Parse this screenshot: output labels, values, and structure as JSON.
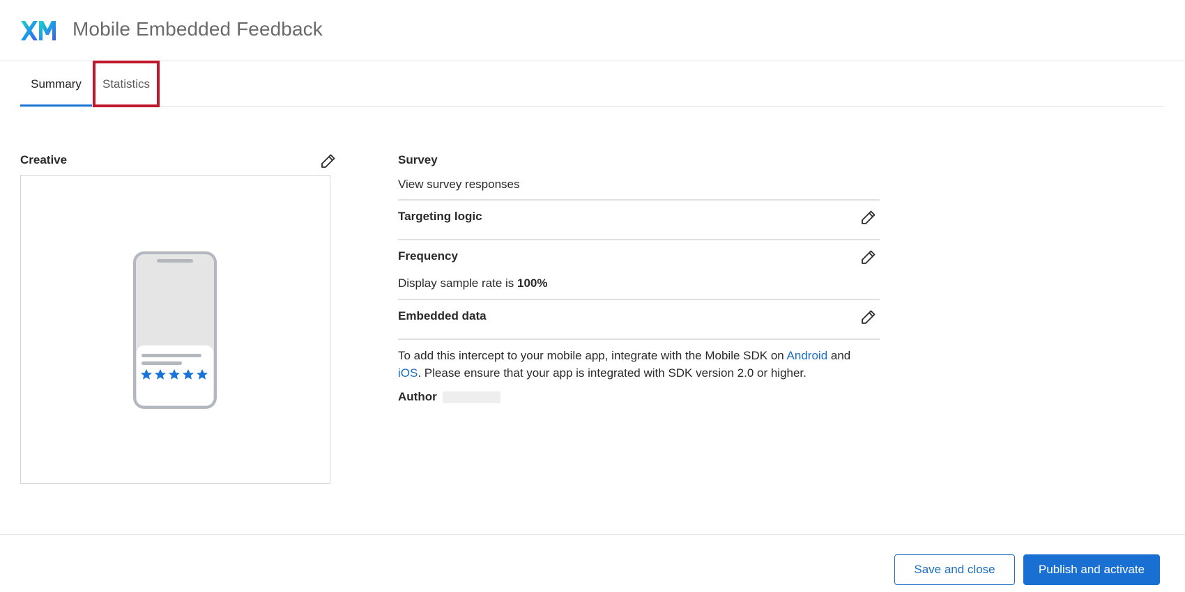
{
  "header": {
    "logo_text": "XM",
    "title": "Mobile Embedded Feedback"
  },
  "tabs": [
    {
      "label": "Summary",
      "active": true
    },
    {
      "label": "Statistics",
      "active": false
    }
  ],
  "creative": {
    "title": "Creative",
    "preview_stars": 5
  },
  "survey": {
    "title": "Survey",
    "link_label": "View survey responses"
  },
  "targeting": {
    "title": "Targeting logic"
  },
  "frequency": {
    "title": "Frequency",
    "text_prefix": "Display sample rate is ",
    "rate": "100%"
  },
  "embedded": {
    "title": "Embedded data"
  },
  "sdk_note": {
    "part1": "To add this intercept to your mobile app, integrate with the Mobile SDK on ",
    "android_link": "Android",
    "part2": " and",
    "ios_link": "iOS",
    "part3": ". Please ensure that your app is integrated with SDK version 2.0 or higher."
  },
  "author": {
    "label": "Author"
  },
  "footer": {
    "save_label": "Save and close",
    "publish_label": "Publish and activate"
  },
  "colors": {
    "accent": "#1a6fd2",
    "link": "#1a6fc4",
    "highlight": "#c0172c",
    "star": "#1a73d6"
  }
}
